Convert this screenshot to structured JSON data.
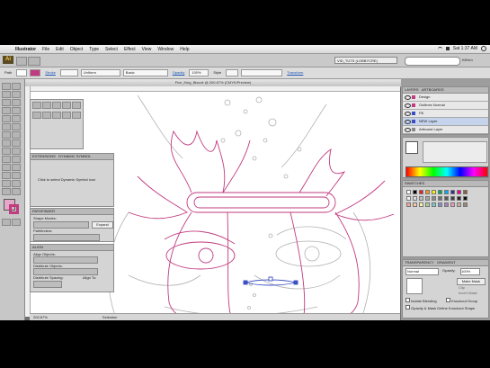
{
  "menubar": {
    "app": "Illustrator",
    "items": [
      "File",
      "Edit",
      "Object",
      "Type",
      "Select",
      "Effect",
      "View",
      "Window",
      "Help"
    ],
    "clock": "Sat 1:37 AM"
  },
  "appbar": {
    "workspace": "VID_TUTS (LOBBYCRE)",
    "search_label": "Kill'em"
  },
  "control": {
    "path_label": "Path",
    "stroke_label": "Stroke",
    "uniform_label": "Uniform",
    "basic_label": "Basic",
    "opacity_label": "Opacity",
    "opacity_value": "100%",
    "style_label": "Style",
    "transform_label": "Transform"
  },
  "document": {
    "title": "Five_King_Biscuit @ 200.67% (CMYK/Preview)"
  },
  "left_panels": {
    "dynamic_panel_tab_a": "EXTENSIONS",
    "dynamic_panel_tab_b": "DYNAMIC SYMBOL",
    "dynamic_message": "Click to select Dynamic Symbol icon",
    "shape_tab": "PATHFINDER",
    "shape_modes": "Shape Modes:",
    "expand_btn": "Expand",
    "pathfinders_label": "Pathfinders:",
    "align_tab": "ALIGN",
    "align_objects": "Align Objects:",
    "distribute_objects": "Distribute Objects:",
    "distribute_spacing": "Distribute Spacing:",
    "align_to": "Align To:"
  },
  "layers": {
    "tab_a": "LAYERS",
    "tab_b": "ARTBOARDS",
    "rows": [
      "Design",
      "Outlines Normal",
      "Fill",
      "NEW Layer",
      "Artboard Layer"
    ]
  },
  "swatches": {
    "tab": "SWATCHES",
    "colors": [
      "#ffffff",
      "#000000",
      "#ed1c24",
      "#f7941d",
      "#fff200",
      "#00a651",
      "#00aeef",
      "#2e3192",
      "#ec008c",
      "#8b5e3c",
      "#f2f2f2",
      "#d9d9d9",
      "#bfbfbf",
      "#a6a6a6",
      "#8c8c8c",
      "#737373",
      "#595959",
      "#404040",
      "#262626",
      "#0d0d0d",
      "#f6a39c",
      "#f9c59c",
      "#fff79c",
      "#a3d39c",
      "#7accc8",
      "#8393ca",
      "#a186be",
      "#f49ac1",
      "#c7b299",
      "#998675"
    ]
  },
  "transparency": {
    "tab_a": "TRANSPARENCY",
    "tab_b": "GRADIENT",
    "mode": "Normal",
    "opacity_label": "Opacity:",
    "opacity_value": "100%",
    "make_mask": "Make Mask",
    "clip": "Clip",
    "invert_mask": "Invert Mask",
    "isolate_blending": "Isolate Blending",
    "knockout_group": "Knockout Group",
    "opacity_mask": "Opacity & Mask Define Knockout Shape"
  },
  "statusbar": {
    "zoom": "200.67%",
    "tool": "Selection"
  },
  "colors": {
    "artwork_stroke": "#c23a7f",
    "artwork_secondary": "#b1b1b1",
    "selection": "#3b4fc4"
  }
}
